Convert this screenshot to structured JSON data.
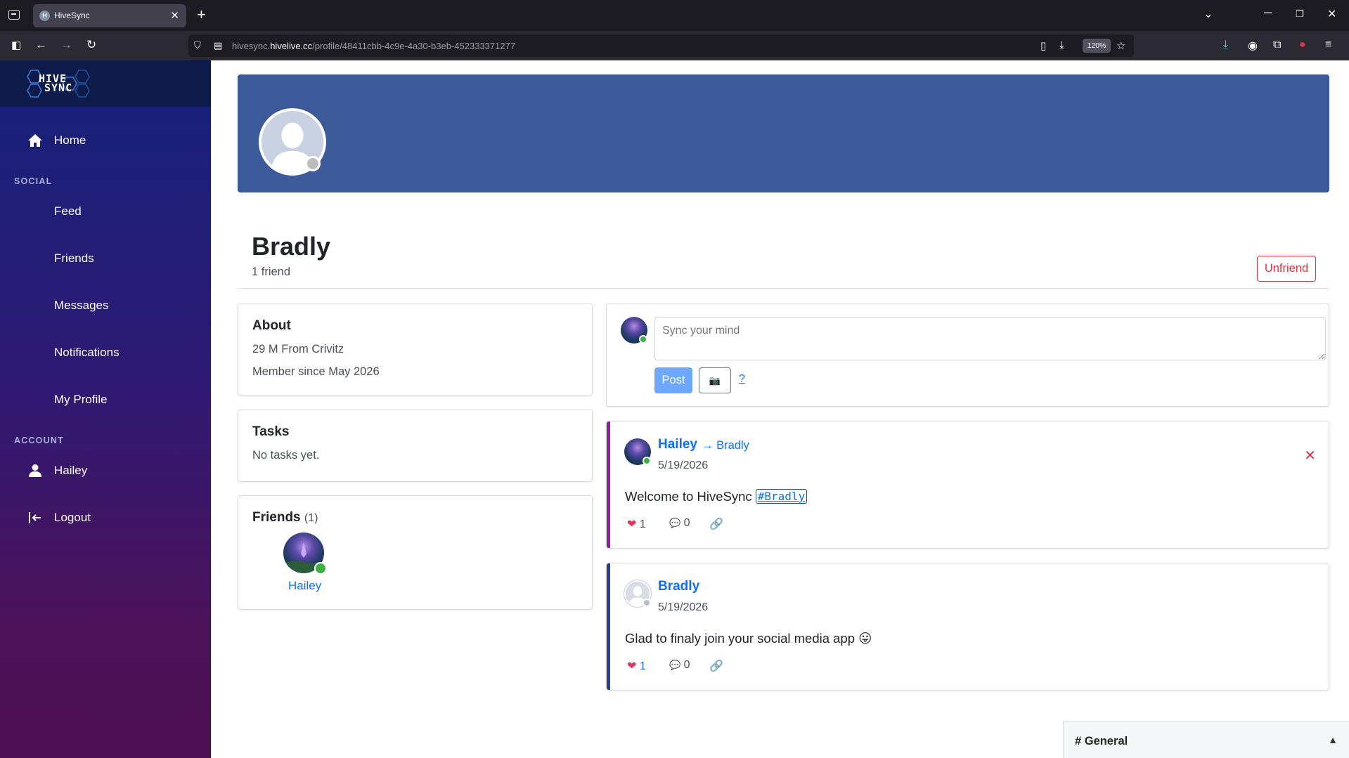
{
  "browser": {
    "tab_title": "HiveSync",
    "tab_favicon_letter": "H",
    "url_prefix": "hivesync.",
    "url_domain": "hivelive.cc",
    "url_path": "/profile/48411cbb-4c9e-4a30-b3eb-452333371277",
    "zoom": "120%"
  },
  "sidebar": {
    "logo_line1": "HIVE",
    "logo_line2": "SYNC",
    "home_label": "Home",
    "social_section": "SOCIAL",
    "feed_label": "Feed",
    "friends_label": "Friends",
    "messages_label": "Messages",
    "notifications_label": "Notifications",
    "my_profile_label": "My Profile",
    "account_section": "ACCOUNT",
    "user_label": "Hailey",
    "logout_label": "Logout"
  },
  "profile": {
    "name": "Bradly",
    "friend_count": "1 friend",
    "unfriend_label": "Unfriend"
  },
  "about": {
    "title": "About",
    "line1": "29 M From Crivitz",
    "line2": "Member since May 2026"
  },
  "tasks": {
    "title": "Tasks",
    "empty": "No tasks yet."
  },
  "friends_card": {
    "title": "Friends",
    "count": "(1)",
    "friend_name": "Hailey"
  },
  "composer": {
    "placeholder": "Sync your mind",
    "post_label": "Post",
    "camera_icon": "📷",
    "help_label": "?"
  },
  "posts": [
    {
      "author": "Hailey",
      "arrow": "→",
      "target": "Bradly",
      "date": "5/19/2026",
      "body": "Welcome to HiveSync",
      "hashtag": "#Bradly",
      "likes": "1",
      "comments": "0",
      "accent": "#8e1fa3"
    },
    {
      "author": "Bradly",
      "date": "5/19/2026",
      "body": "Glad to finaly join your social media app",
      "emoji": "😛",
      "likes": "1",
      "comments": "0",
      "accent": "#2a3f8f"
    }
  ],
  "chat": {
    "label": "# General",
    "caret": "▲"
  },
  "colors": {
    "banner": "#3c5a9a",
    "primary": "#0d6efd",
    "danger": "#dc3545",
    "online": "#3cb043"
  }
}
